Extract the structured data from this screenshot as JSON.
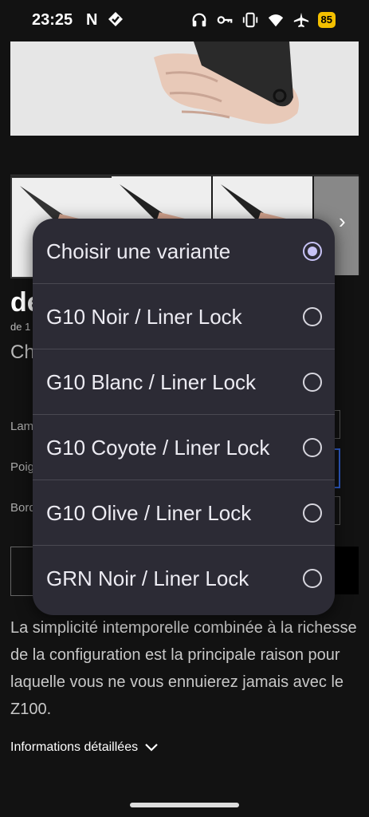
{
  "status_bar": {
    "time": "23:25",
    "notification_letter": "N",
    "battery": "85",
    "icons": [
      "headphones-icon",
      "key-icon",
      "vibrate-icon",
      "wifi-icon",
      "airplane-icon"
    ]
  },
  "product": {
    "title_partial": "de",
    "subtitle_partial": "de 1",
    "choose_partial": "Ch",
    "option_labels_partial": [
      "Lam",
      "Poig",
      "Bord"
    ],
    "description": "La simplicité intemporelle combinée à la richesse de la configuration est la principale raison pour laquelle vous ne vous ennuierez jamais avec le Z100.",
    "details_link": "Informations détaillées"
  },
  "variant_dialog": {
    "options": [
      {
        "label": "Choisir une variante",
        "selected": true
      },
      {
        "label": "G10 Noir / Liner Lock",
        "selected": false
      },
      {
        "label": "G10 Blanc / Liner Lock",
        "selected": false
      },
      {
        "label": "G10 Coyote / Liner Lock",
        "selected": false
      },
      {
        "label": "G10 Olive / Liner Lock",
        "selected": false
      },
      {
        "label": "GRN Noir / Liner Lock",
        "selected": false
      }
    ]
  },
  "colors": {
    "background": "#121212",
    "dialog": "#2c2b35",
    "radio_selected": "#c7c2f5",
    "battery": "#f4c000"
  }
}
